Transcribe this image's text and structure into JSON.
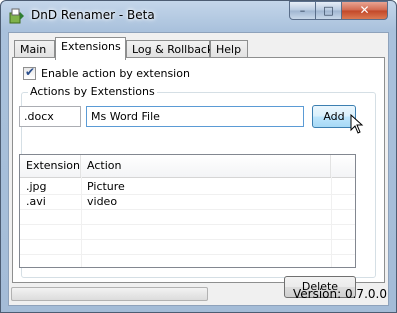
{
  "window": {
    "title": "DnD Renamer - Beta",
    "min_glyph": "–",
    "max_glyph": "□",
    "close_glyph": "✕"
  },
  "tabs": [
    {
      "label": "Main",
      "active": false
    },
    {
      "label": "Extensions",
      "active": true
    },
    {
      "label": "Log & Rollback",
      "active": false
    },
    {
      "label": "Help",
      "active": false
    }
  ],
  "extensions": {
    "enable_checkbox": {
      "label": "Enable action by extension",
      "checked": true,
      "check_glyph": "✔"
    },
    "group_title": "Actions by Extenstions",
    "extension_input": "docx",
    "action_input": "Ms Word File",
    "add_button": "Add",
    "list": {
      "columns": [
        "Extension",
        "Action"
      ],
      "rows": [
        {
          "extension": ".jpg",
          "action": "Picture"
        },
        {
          "extension": ".avi",
          "action": "video"
        }
      ]
    },
    "delete_button": "Delete"
  },
  "status": {
    "progress": 0,
    "version": "Version: 0.7.0.0"
  },
  "colors": {
    "accent": "#5b9bd5",
    "close": "#c24728"
  }
}
